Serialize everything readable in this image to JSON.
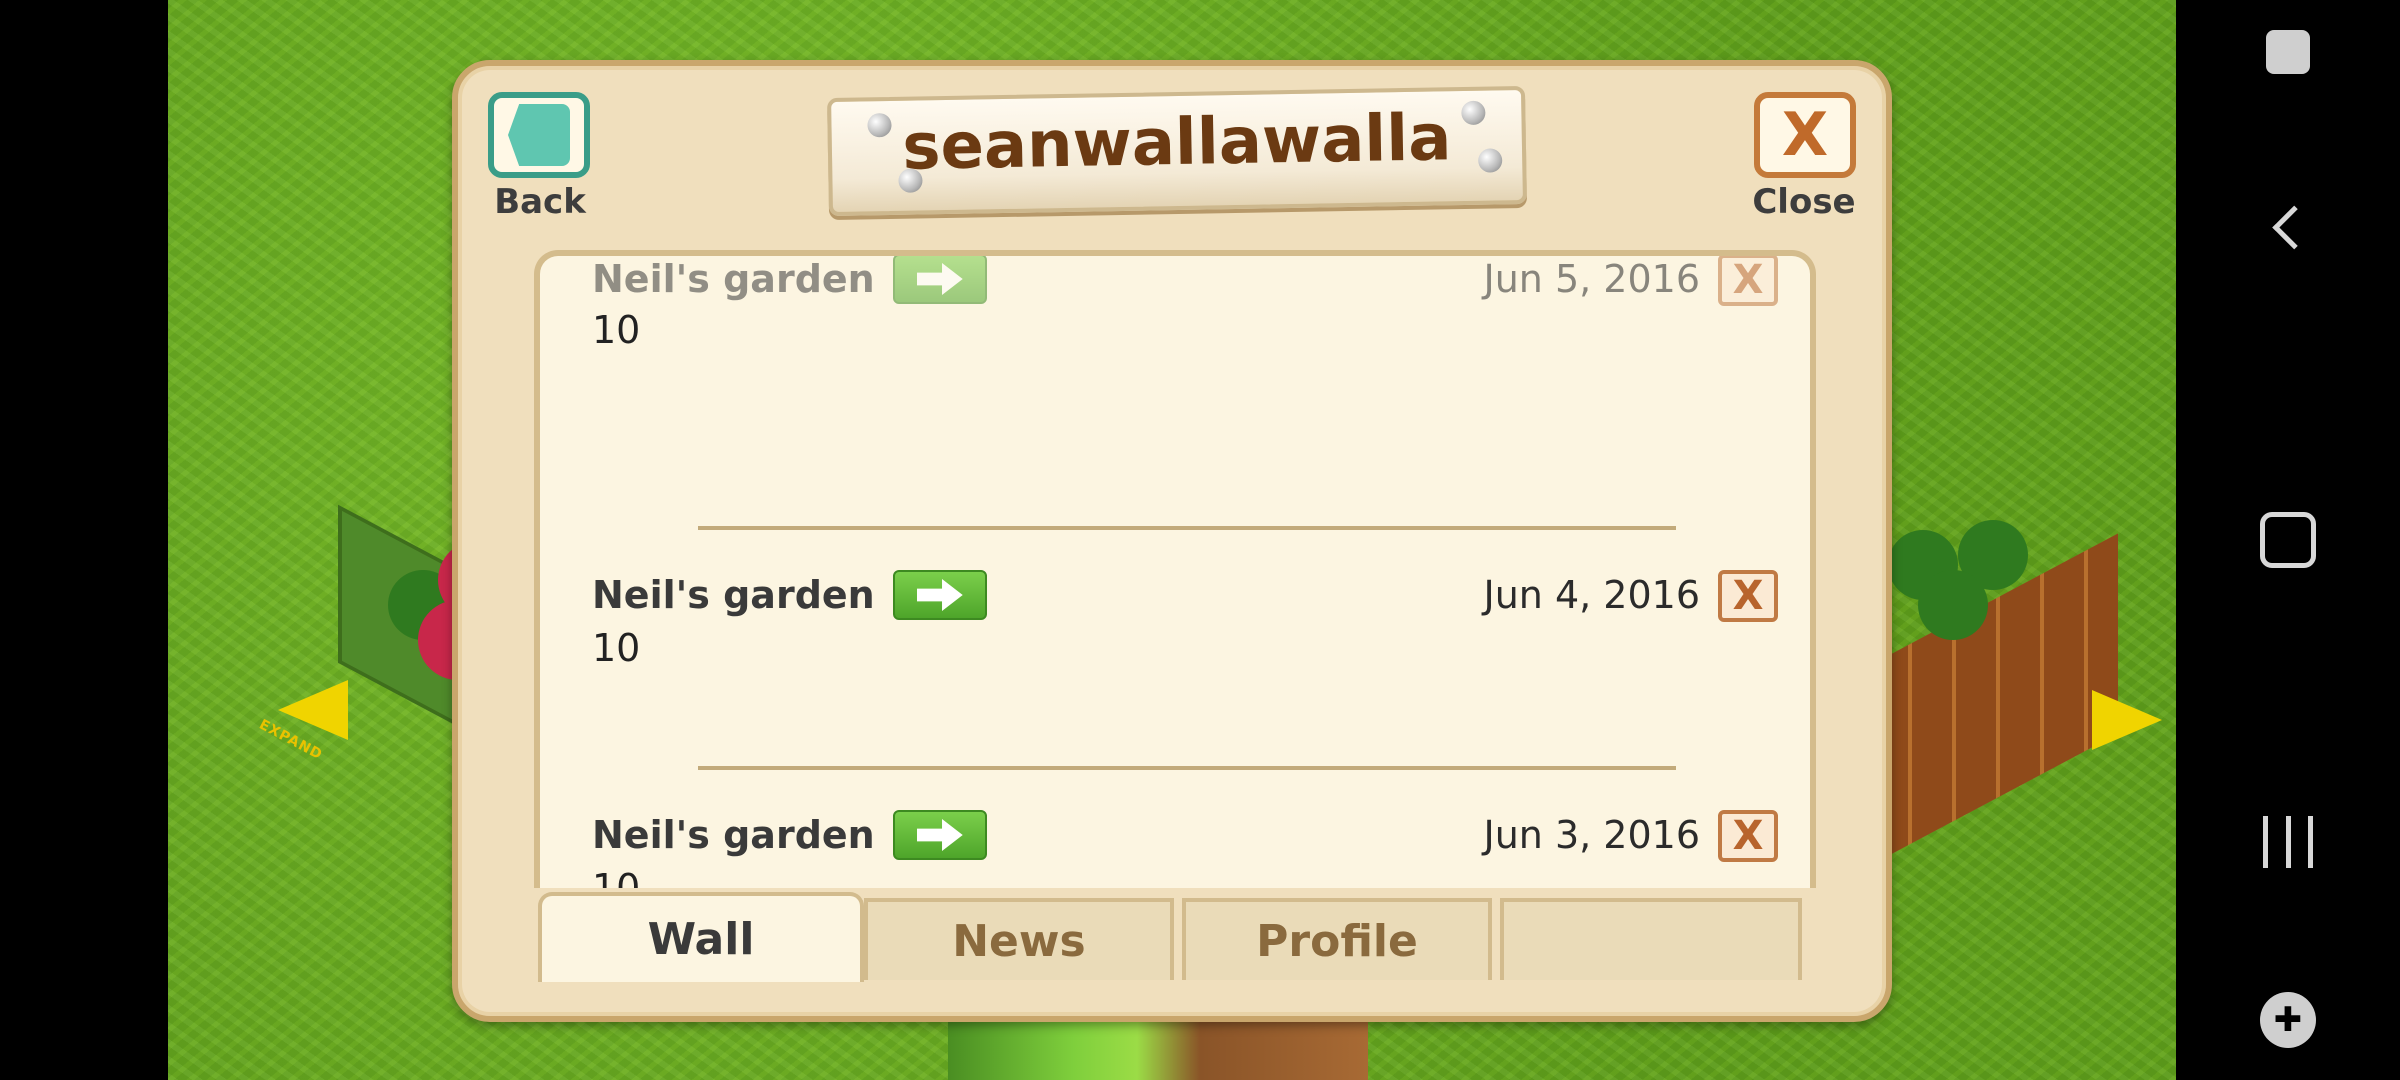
{
  "dialog": {
    "title": "seanwallawalla",
    "back_label": "Back",
    "close_label": "Close",
    "close_glyph": "X"
  },
  "posts": [
    {
      "name": "Neil's garden",
      "date": "Jun 5, 2016",
      "body": "10",
      "delete_glyph": "X"
    },
    {
      "name": "Neil's garden",
      "date": "Jun 4, 2016",
      "body": "10",
      "delete_glyph": "X"
    },
    {
      "name": "Neil's garden",
      "date": "Jun 3, 2016",
      "body": "10",
      "delete_glyph": "X"
    }
  ],
  "tabs": [
    {
      "label": "Wall",
      "active": true
    },
    {
      "label": "News",
      "active": false
    },
    {
      "label": "Profile",
      "active": false
    },
    {
      "label": "",
      "active": false
    }
  ],
  "icons": {
    "back": "back-triangle-icon",
    "close": "close-x-icon",
    "go": "right-arrow-icon",
    "delete": "delete-x-icon"
  },
  "colors": {
    "dialog_bg": "#f0dfbd",
    "panel_bg": "#fcf5e1",
    "title_text": "#6b3a12",
    "go_button": "#5cb638",
    "back_button_border": "#3a9d88",
    "close_button_border": "#c47a3a"
  }
}
